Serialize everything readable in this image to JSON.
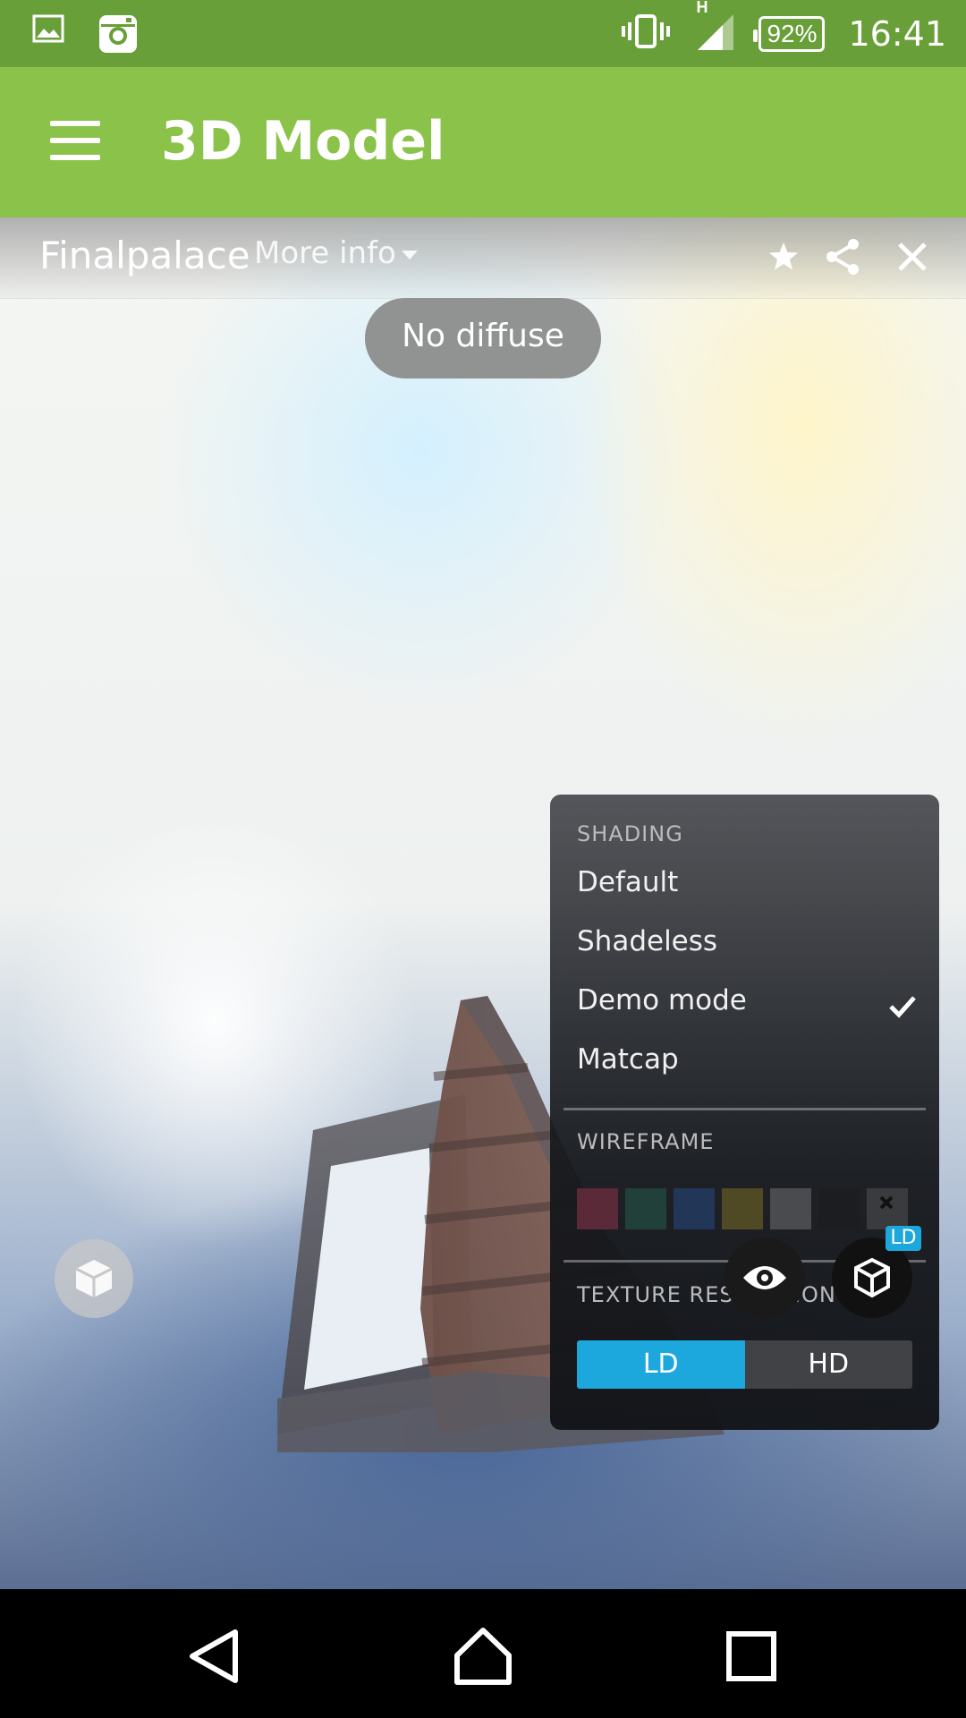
{
  "status_bar": {
    "network_type": "H",
    "battery": "92%",
    "time": "16:41",
    "icons": [
      "gallery-icon",
      "instagram-icon",
      "vibrate-icon",
      "signal-icon",
      "battery-icon"
    ]
  },
  "app_bar": {
    "title": "3D Model",
    "menu_icon": "hamburger-menu-icon"
  },
  "viewer": {
    "model_name": "Finalpalace",
    "more_info_label": "More info",
    "toast": "No diffuse",
    "header_icons": [
      "star-icon",
      "share-icon",
      "close-icon"
    ]
  },
  "settings_panel": {
    "shading_label": "SHADING",
    "shading_options": [
      {
        "label": "Default",
        "selected": false
      },
      {
        "label": "Shadeless",
        "selected": false
      },
      {
        "label": "Demo mode",
        "selected": true
      },
      {
        "label": "Matcap",
        "selected": false
      }
    ],
    "wireframe_label": "WIREFRAME",
    "wireframe_colors": [
      "#5a2a38",
      "#22403a",
      "#223658",
      "#4f4a24",
      "#4a4b4f",
      "#1c1d20",
      "#3a3b3e"
    ],
    "texture_label": "TEXTURE RESOLUTION",
    "texture_options": [
      "LD",
      "HD"
    ],
    "texture_selected": "LD"
  },
  "viewer_controls": {
    "resolution_badge": "LD"
  },
  "colors": {
    "status_bar": "#689f38",
    "app_bar": "#8bc34a",
    "accent": "#1ca8dd"
  }
}
